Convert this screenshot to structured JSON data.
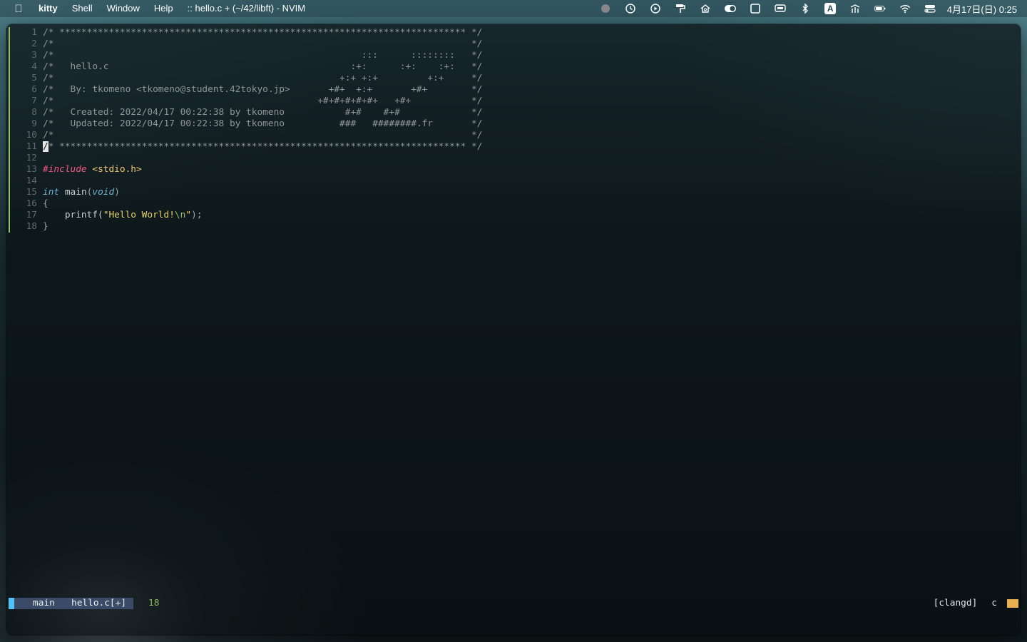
{
  "menubar": {
    "app_name": "kitty",
    "menus": [
      "Shell",
      "Window",
      "Help"
    ],
    "window_title": ":: hello.c + (~/42/libft) - NVIM",
    "tray_icons": [
      "record-dot-icon",
      "time-machine-icon",
      "play-circle-icon",
      "paint-roller-icon",
      "home-icon",
      "toggle-icon",
      "window-icon",
      "cast-icon",
      "bluetooth-icon",
      "input-source-icon",
      "network-icon",
      "battery-icon",
      "wifi-icon",
      "control-center-icon"
    ],
    "input_source_label": "A",
    "clock": "4月17日(日) 0:25"
  },
  "editor": {
    "line_numbers": [
      "1",
      "2",
      "3",
      "4",
      "5",
      "6",
      "7",
      "8",
      "9",
      "10",
      "11",
      "12",
      "13",
      "14",
      "15",
      "16",
      "17",
      "18"
    ],
    "header_lines": [
      "/* ************************************************************************** */",
      "/*                                                                            */",
      "/*                                                        :::      ::::::::   */",
      "/*   hello.c                                            :+:      :+:    :+:   */",
      "/*                                                    +:+ +:+         +:+     */",
      "/*   By: tkomeno <tkomeno@student.42tokyo.jp>       +#+  +:+       +#+        */",
      "/*                                                +#+#+#+#+#+   +#+           */",
      "/*   Created: 2022/04/17 00:22:38 by tkomeno           #+#    #+#             */",
      "/*   Updated: 2022/04/17 00:22:38 by tkomeno          ###   ########.fr       */",
      "/*                                                                            */"
    ],
    "line11_cursor_char": "/",
    "line11_rest": "* ************************************************************************** */",
    "include_kw": "#include",
    "include_hdr": "<stdio.h>",
    "type_int": "int",
    "fn_main": "main",
    "paren_open": "(",
    "type_void": "void",
    "paren_close": ")",
    "brace_open": "{",
    "printf_fn": "    printf(",
    "str_open": "\"Hello World!",
    "str_esc": "\\n",
    "str_close": "\"",
    "printf_end": ");",
    "brace_close": "}"
  },
  "statusline": {
    "branch_icon": "",
    "branch": "main",
    "filename": "hello.c[+]",
    "diff_icon": "",
    "diff_added": "18",
    "tree_icon": "",
    "lsp": "[clangd]",
    "filetype_icon": "",
    "filetype": "c"
  },
  "colors": {
    "mode_block": "#4fc3f7",
    "branch_bg": "#3b4a66",
    "git_added": "#8fbc5e",
    "keyword_preproc": "#f7577c",
    "type": "#6fb3d2",
    "string": "#e3d26a"
  }
}
